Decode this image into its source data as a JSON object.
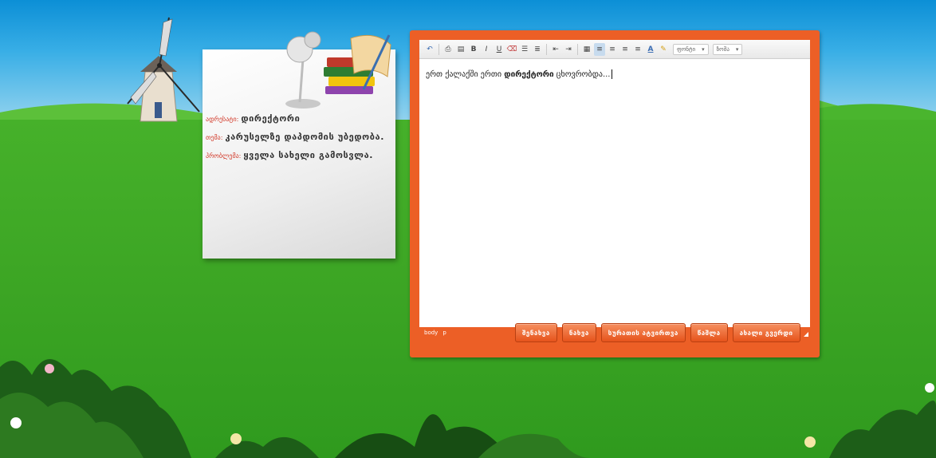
{
  "colors": {
    "accent": "#ec5f26",
    "sky": "#38aee6",
    "grass": "#3ca524",
    "label_red": "#d23a2a"
  },
  "note": {
    "rows": [
      {
        "label": "ადრესატი:",
        "value": "დირექტორი"
      },
      {
        "label": "თემა:",
        "value": "კარუსელზე დაპდომის უბედობა."
      },
      {
        "label": "პრობლემა:",
        "value": "ყველა სახელი გამოსვლა."
      }
    ]
  },
  "toolbar": {
    "icons": [
      "undo-icon",
      "print-icon",
      "preview-icon",
      "bold-icon",
      "italic-icon",
      "underline-icon",
      "clear-format-icon",
      "bullet-list-icon",
      "numbered-list-icon",
      "outdent-icon",
      "indent-icon",
      "paste-icon",
      "align-left-icon",
      "align-center-icon",
      "align-right-icon",
      "align-justify-icon",
      "font-color-icon",
      "highlight-icon"
    ],
    "bold_label": "B",
    "italic_label": "I",
    "underline_label": "U",
    "font_color_label": "A",
    "font_select": "ფონტი",
    "size_select": "ზომა"
  },
  "editor": {
    "text_before": "ერთ ქალაქში ერთი ",
    "text_bold": "დირექტორი",
    "text_after": " ცხოვრობდა..."
  },
  "statusbar": {
    "path_1": "body",
    "path_2": "p"
  },
  "buttons": {
    "save": "შენახვა",
    "view": "ნახვა",
    "attach": "სურათის ატვირთვა",
    "send": "წაშლა",
    "new": "ახალი გვერდი"
  }
}
